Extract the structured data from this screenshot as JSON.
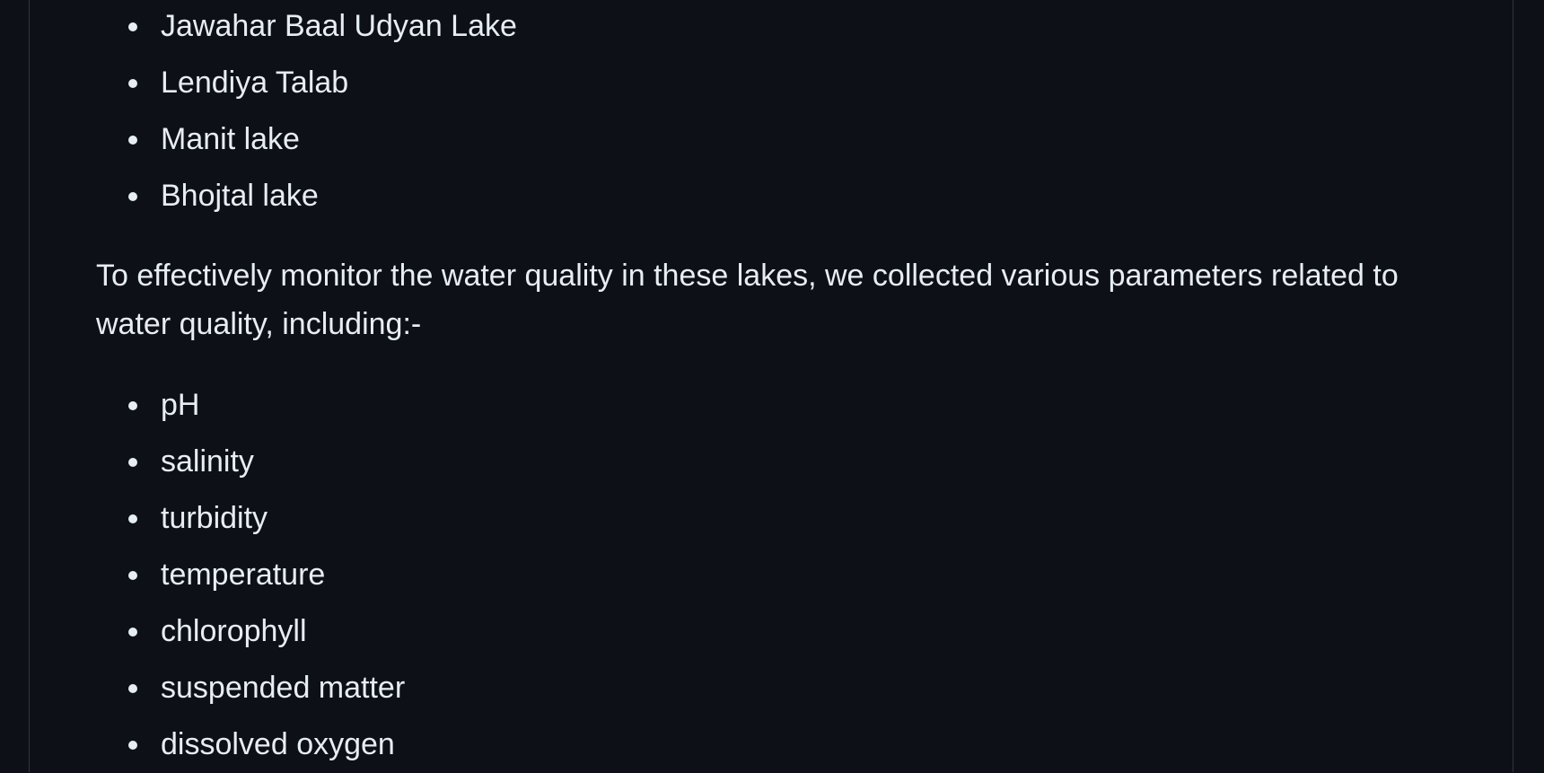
{
  "lakes": [
    "Jawahar Baal Udyan Lake",
    "Lendiya Talab",
    "Manit lake",
    "Bhojtal lake"
  ],
  "paragraph": "To effectively monitor the water quality in these lakes, we collected various parameters related to water quality, including:-",
  "parameters": [
    "pH",
    "salinity",
    "turbidity",
    "temperature",
    "chlorophyll",
    "suspended matter",
    "dissolved oxygen"
  ],
  "colors": {
    "background": "#0d1117",
    "text": "#e6edf3",
    "border": "#30363d"
  }
}
